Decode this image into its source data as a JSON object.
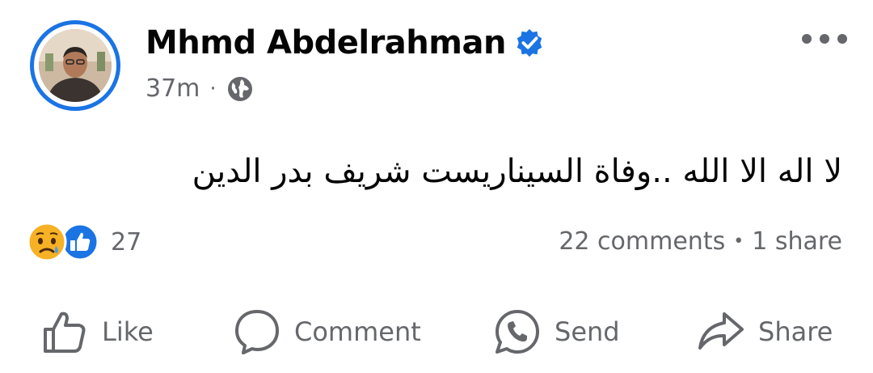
{
  "post": {
    "author": "Mhmd Abdelrahman",
    "time": "37m",
    "separator": "·",
    "text": "لا اله الا الله ..وفاة السيناريست شريف بدر الدين",
    "reaction_count": "27",
    "comments": "22 comments",
    "shares": "1 share",
    "counts_separator": "•"
  },
  "actions": {
    "like": "Like",
    "comment": "Comment",
    "send": "Send",
    "share": "Share"
  },
  "colors": {
    "brand_blue": "#1b74e4",
    "text_secondary": "#65676b",
    "text_primary": "#050505"
  },
  "icons": [
    "verified-badge-icon",
    "globe-icon",
    "more-options-icon",
    "sad-reaction-icon",
    "like-reaction-icon",
    "like-icon",
    "comment-icon",
    "whatsapp-send-icon",
    "share-icon"
  ]
}
